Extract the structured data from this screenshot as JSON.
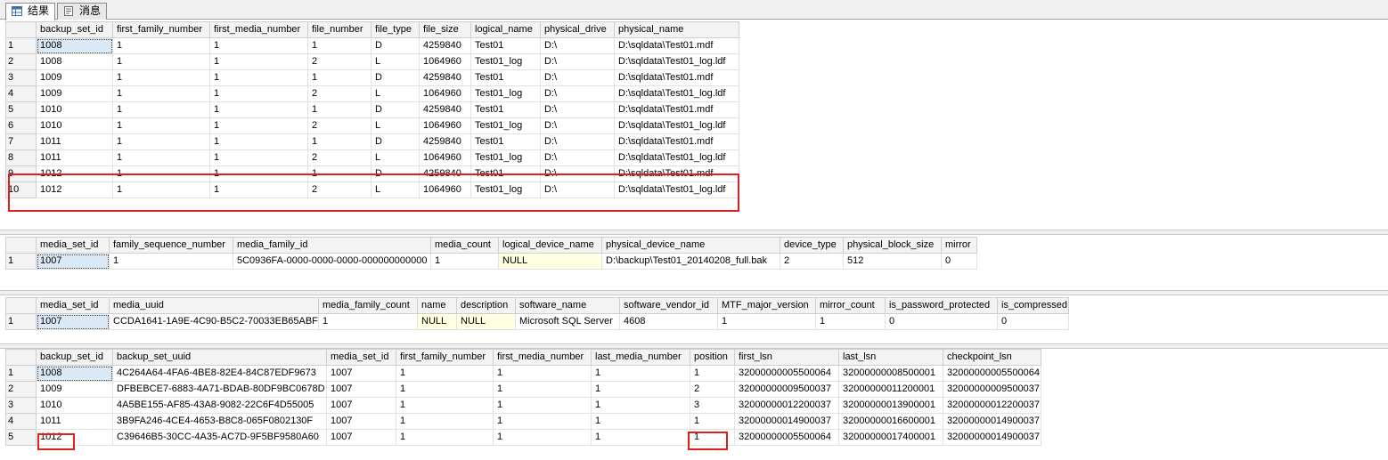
{
  "tabs": [
    {
      "label": "结果",
      "icon": "grid-icon",
      "active": true
    },
    {
      "label": "消息",
      "icon": "messages-icon",
      "active": false
    }
  ],
  "grid1": {
    "columns": [
      "backup_set_id",
      "first_family_number",
      "first_media_number",
      "file_number",
      "file_type",
      "file_size",
      "logical_name",
      "physical_drive",
      "physical_name"
    ],
    "rows": [
      [
        "1",
        "1008",
        "1",
        "1",
        "1",
        "D",
        "4259840",
        "Test01",
        "D:\\",
        "D:\\sqldata\\Test01.mdf"
      ],
      [
        "2",
        "1008",
        "1",
        "1",
        "2",
        "L",
        "1064960",
        "Test01_log",
        "D:\\",
        "D:\\sqldata\\Test01_log.ldf"
      ],
      [
        "3",
        "1009",
        "1",
        "1",
        "1",
        "D",
        "4259840",
        "Test01",
        "D:\\",
        "D:\\sqldata\\Test01.mdf"
      ],
      [
        "4",
        "1009",
        "1",
        "1",
        "2",
        "L",
        "1064960",
        "Test01_log",
        "D:\\",
        "D:\\sqldata\\Test01_log.ldf"
      ],
      [
        "5",
        "1010",
        "1",
        "1",
        "1",
        "D",
        "4259840",
        "Test01",
        "D:\\",
        "D:\\sqldata\\Test01.mdf"
      ],
      [
        "6",
        "1010",
        "1",
        "1",
        "2",
        "L",
        "1064960",
        "Test01_log",
        "D:\\",
        "D:\\sqldata\\Test01_log.ldf"
      ],
      [
        "7",
        "1011",
        "1",
        "1",
        "1",
        "D",
        "4259840",
        "Test01",
        "D:\\",
        "D:\\sqldata\\Test01.mdf"
      ],
      [
        "8",
        "1011",
        "1",
        "1",
        "2",
        "L",
        "1064960",
        "Test01_log",
        "D:\\",
        "D:\\sqldata\\Test01_log.ldf"
      ],
      [
        "9",
        "1012",
        "1",
        "1",
        "1",
        "D",
        "4259840",
        "Test01",
        "D:\\",
        "D:\\sqldata\\Test01.mdf"
      ],
      [
        "10",
        "1012",
        "1",
        "1",
        "2",
        "L",
        "1064960",
        "Test01_log",
        "D:\\",
        "D:\\sqldata\\Test01_log.ldf"
      ]
    ]
  },
  "grid2": {
    "columns": [
      "media_set_id",
      "family_sequence_number",
      "media_family_id",
      "media_count",
      "logical_device_name",
      "physical_device_name",
      "device_type",
      "physical_block_size",
      "mirror"
    ],
    "rows": [
      [
        "1",
        "1007",
        "1",
        "5C0936FA-0000-0000-0000-000000000000",
        "1",
        "NULL",
        "D:\\backup\\Test01_20140208_full.bak",
        "2",
        "512",
        "0"
      ]
    ]
  },
  "grid3": {
    "columns": [
      "media_set_id",
      "media_uuid",
      "media_family_count",
      "name",
      "description",
      "software_name",
      "software_vendor_id",
      "MTF_major_version",
      "mirror_count",
      "is_password_protected",
      "is_compressed"
    ],
    "rows": [
      [
        "1",
        "1007",
        "CCDA1641-1A9E-4C90-B5C2-70033EB65ABF",
        "1",
        "NULL",
        "NULL",
        "Microsoft SQL Server",
        "4608",
        "1",
        "1",
        "0",
        "0"
      ]
    ]
  },
  "grid4": {
    "columns": [
      "backup_set_id",
      "backup_set_uuid",
      "media_set_id",
      "first_family_number",
      "first_media_number",
      "last_media_number",
      "position",
      "first_lsn",
      "last_lsn",
      "checkpoint_lsn"
    ],
    "rows": [
      [
        "1",
        "1008",
        "4C264A64-4FA6-4BE8-82E4-84C87EDF9673",
        "1007",
        "1",
        "1",
        "1",
        "1",
        "32000000005500064",
        "32000000008500001",
        "32000000005500064"
      ],
      [
        "2",
        "1009",
        "DFBEBCE7-6883-4A71-BDAB-80DF9BC0678D",
        "1007",
        "1",
        "1",
        "1",
        "2",
        "32000000009500037",
        "32000000011200001",
        "32000000009500037"
      ],
      [
        "3",
        "1010",
        "4A5BE155-AF85-43A8-9082-22C6F4D55005",
        "1007",
        "1",
        "1",
        "1",
        "3",
        "32000000012200037",
        "32000000013900001",
        "32000000012200037"
      ],
      [
        "4",
        "1011",
        "3B9FA246-4CE4-4653-B8C8-065F0802130F",
        "1007",
        "1",
        "1",
        "1",
        "1",
        "32000000014900037",
        "32000000016600001",
        "32000000014900037"
      ],
      [
        "5",
        "1012",
        "C39646B5-30CC-4A35-AC7D-9F5BF9580A60",
        "1007",
        "1",
        "1",
        "1",
        "1",
        "32000000005500064",
        "32000000017400001",
        "32000000014900037"
      ]
    ]
  },
  "colors": {
    "highlight": "#e0201e",
    "null_cell": "#ffffe1",
    "selected_cell": "#dbe9f7"
  }
}
